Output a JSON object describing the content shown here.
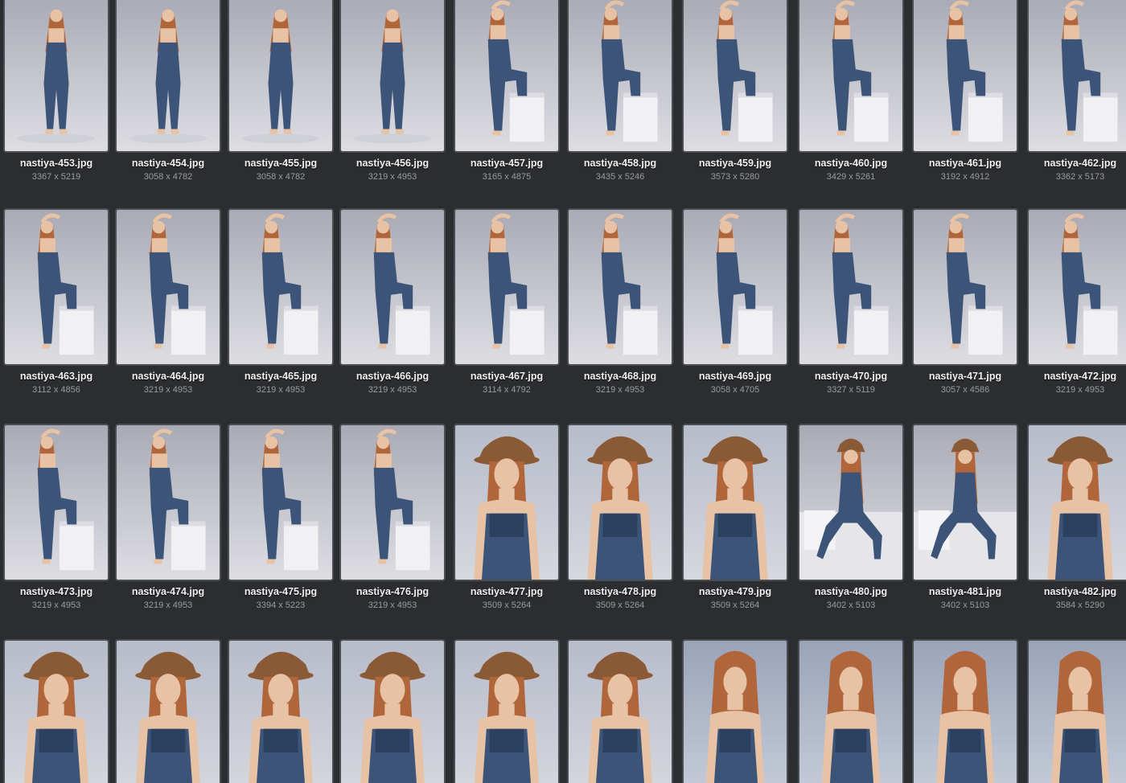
{
  "gallery": {
    "accent_color": "#4a4d52",
    "thumbnail_icon": "photo-thumbnail-icon",
    "rows": [
      [
        {
          "name": "nastiya-453.jpg",
          "size": "3367 x 5219",
          "style": "full"
        },
        {
          "name": "nastiya-454.jpg",
          "size": "3058 x 4782",
          "style": "full"
        },
        {
          "name": "nastiya-455.jpg",
          "size": "3058 x 4782",
          "style": "full"
        },
        {
          "name": "nastiya-456.jpg",
          "size": "3219 x 4953",
          "style": "full"
        },
        {
          "name": "nastiya-457.jpg",
          "size": "3165 x 4875",
          "style": "box"
        },
        {
          "name": "nastiya-458.jpg",
          "size": "3435 x 5246",
          "style": "box"
        },
        {
          "name": "nastiya-459.jpg",
          "size": "3573 x 5280",
          "style": "box"
        },
        {
          "name": "nastiya-460.jpg",
          "size": "3429 x 5261",
          "style": "box"
        },
        {
          "name": "nastiya-461.jpg",
          "size": "3192 x 4912",
          "style": "box"
        },
        {
          "name": "nastiya-462.jpg",
          "size": "3362 x 5173",
          "style": "box"
        }
      ],
      [
        {
          "name": "nastiya-463.jpg",
          "size": "3112 x 4856",
          "style": "box"
        },
        {
          "name": "nastiya-464.jpg",
          "size": "3219 x 4953",
          "style": "box"
        },
        {
          "name": "nastiya-465.jpg",
          "size": "3219 x 4953",
          "style": "box"
        },
        {
          "name": "nastiya-466.jpg",
          "size": "3219 x 4953",
          "style": "box"
        },
        {
          "name": "nastiya-467.jpg",
          "size": "3114 x 4792",
          "style": "box"
        },
        {
          "name": "nastiya-468.jpg",
          "size": "3219 x 4953",
          "style": "box"
        },
        {
          "name": "nastiya-469.jpg",
          "size": "3058 x 4705",
          "style": "box"
        },
        {
          "name": "nastiya-470.jpg",
          "size": "3327 x 5119",
          "style": "box"
        },
        {
          "name": "nastiya-471.jpg",
          "size": "3057 x 4586",
          "style": "box"
        },
        {
          "name": "nastiya-472.jpg",
          "size": "3219 x 4953",
          "style": "box"
        }
      ],
      [
        {
          "name": "nastiya-473.jpg",
          "size": "3219 x 4953",
          "style": "box"
        },
        {
          "name": "nastiya-474.jpg",
          "size": "3219 x 4953",
          "style": "box"
        },
        {
          "name": "nastiya-475.jpg",
          "size": "3394 x 5223",
          "style": "box"
        },
        {
          "name": "nastiya-476.jpg",
          "size": "3219 x 4953",
          "style": "box"
        },
        {
          "name": "nastiya-477.jpg",
          "size": "3509 x 5264",
          "style": "portrait"
        },
        {
          "name": "nastiya-478.jpg",
          "size": "3509 x 5264",
          "style": "portrait"
        },
        {
          "name": "nastiya-479.jpg",
          "size": "3509 x 5264",
          "style": "portrait"
        },
        {
          "name": "nastiya-480.jpg",
          "size": "3402 x 5103",
          "style": "seated"
        },
        {
          "name": "nastiya-481.jpg",
          "size": "3402 x 5103",
          "style": "seated"
        },
        {
          "name": "nastiya-482.jpg",
          "size": "3584 x 5290",
          "style": "portrait"
        }
      ],
      [
        {
          "name": "",
          "size": "",
          "style": "portrait"
        },
        {
          "name": "",
          "size": "",
          "style": "portrait"
        },
        {
          "name": "",
          "size": "",
          "style": "portrait"
        },
        {
          "name": "",
          "size": "",
          "style": "portrait"
        },
        {
          "name": "",
          "size": "",
          "style": "portrait"
        },
        {
          "name": "",
          "size": "",
          "style": "portrait"
        },
        {
          "name": "",
          "size": "",
          "style": "nohat"
        },
        {
          "name": "",
          "size": "",
          "style": "nohat"
        },
        {
          "name": "",
          "size": "",
          "style": "nohat"
        },
        {
          "name": "",
          "size": "",
          "style": "nohat"
        }
      ]
    ]
  }
}
